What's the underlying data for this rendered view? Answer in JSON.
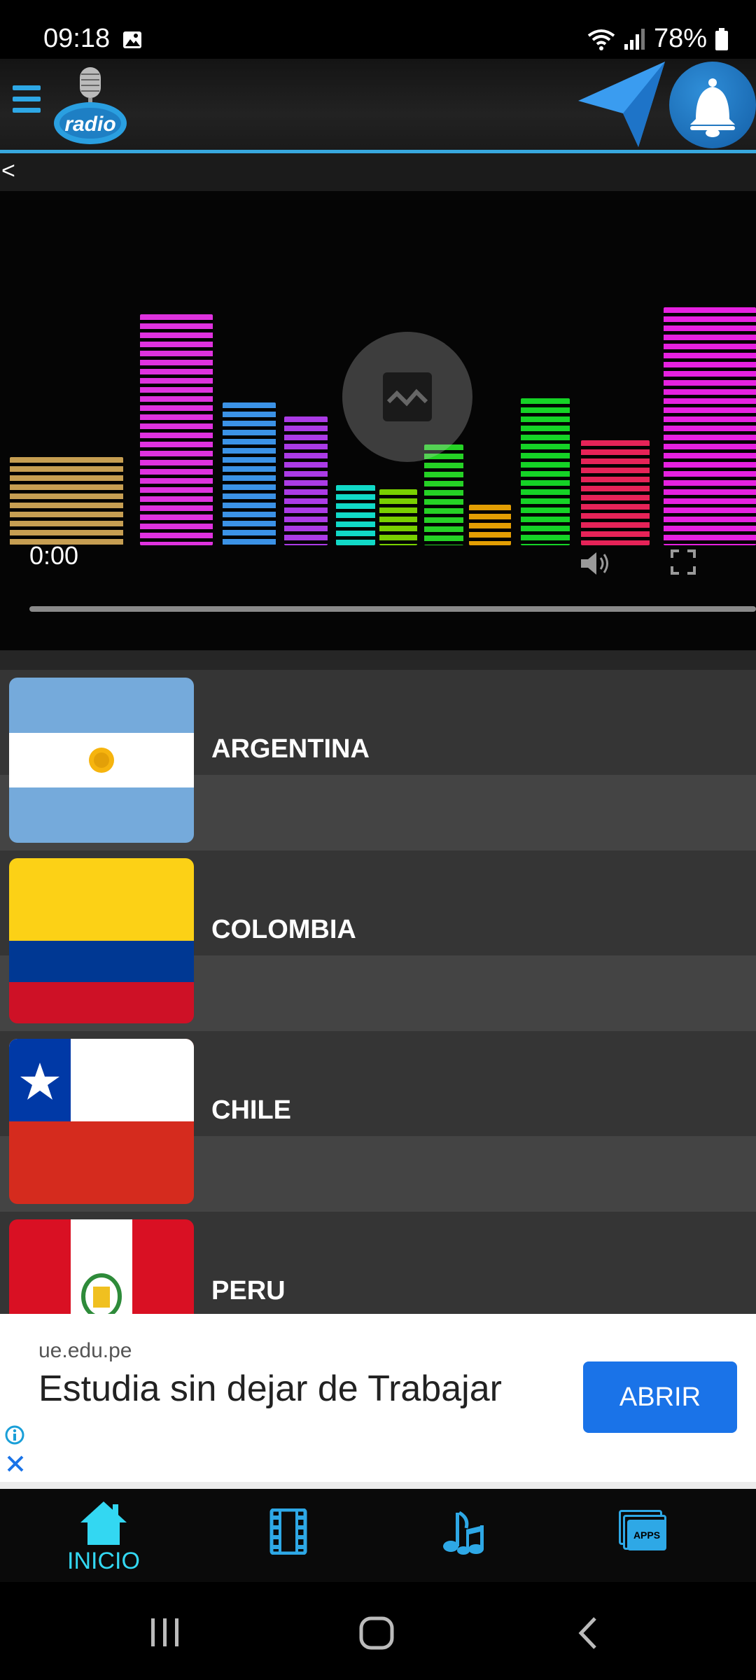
{
  "status_bar": {
    "time": "09:18",
    "battery": "78%"
  },
  "header": {
    "logo_alt": "radio"
  },
  "back_label": "<",
  "video": {
    "time": "0:00"
  },
  "countries": [
    {
      "name": "ARGENTINA"
    },
    {
      "name": "COLOMBIA"
    },
    {
      "name": "CHILE"
    },
    {
      "name": "PERU"
    }
  ],
  "ad": {
    "domain": "ue.edu.pe",
    "headline": "Estudia sin dejar de Trabajar",
    "button": "ABRIR"
  },
  "bottom_nav": {
    "home_label": "INICIO",
    "apps_label": "APPS"
  },
  "colors": {
    "accent": "#38a8de",
    "nav_active": "#33d7f2",
    "ad_button": "#1a73e8"
  }
}
